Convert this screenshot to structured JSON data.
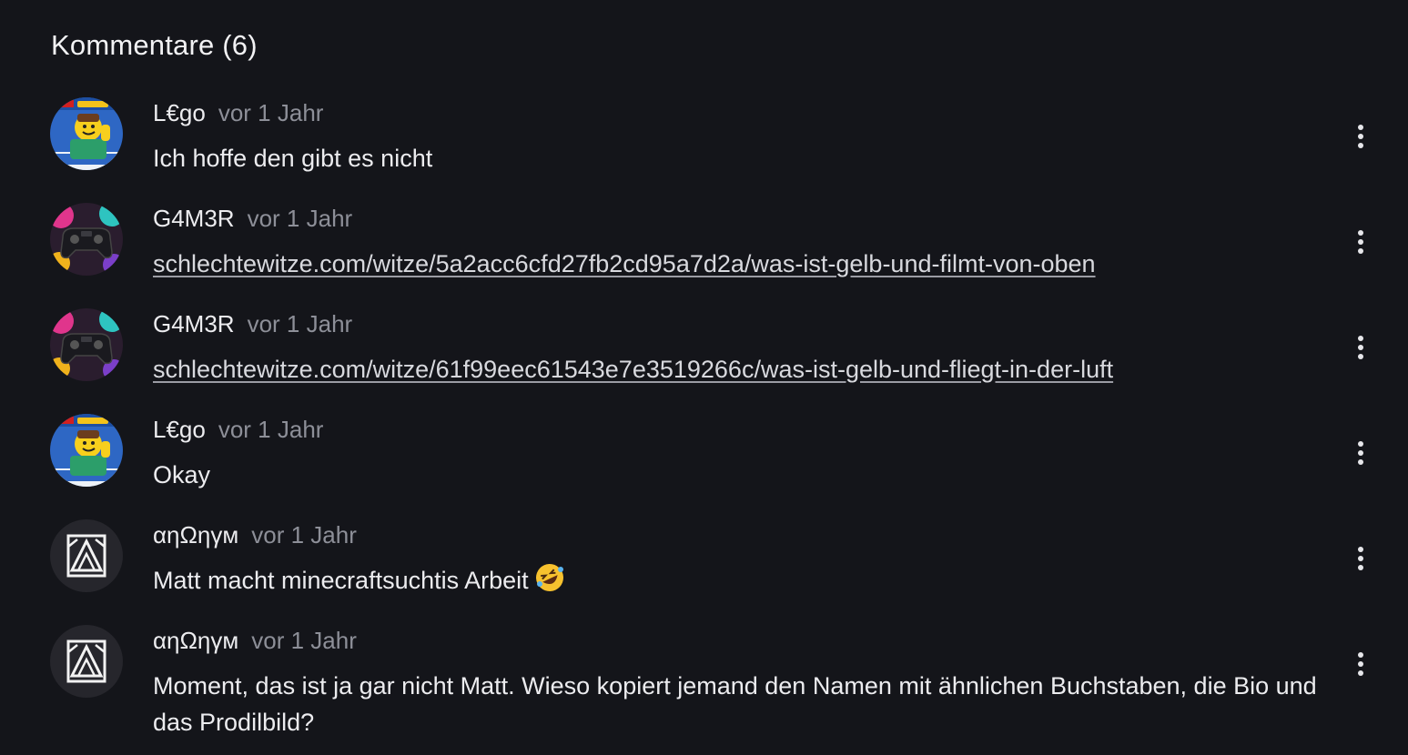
{
  "section": {
    "title": "Kommentare (6)"
  },
  "comments": [
    {
      "author": "L€go",
      "time": "vor 1 Jahr",
      "text": "Ich hoffe den gibt es nicht",
      "avatar_icon": "lego-worlds-avatar"
    },
    {
      "author": "G4M3R",
      "time": "vor 1 Jahr",
      "link": "schlechtewitze.com/witze/5a2acc6cfd27fb2cd95a7d2a/was-ist-gelb-und-filmt-von-oben",
      "avatar_icon": "gamepad-avatar"
    },
    {
      "author": "G4M3R",
      "time": "vor 1 Jahr",
      "link": "schlechtewitze.com/witze/61f99eec61543e7e3519266c/was-ist-gelb-und-fliegt-in-der-luft",
      "avatar_icon": "gamepad-avatar"
    },
    {
      "author": "L€go",
      "time": "vor 1 Jahr",
      "text": "Okay",
      "avatar_icon": "lego-worlds-avatar"
    },
    {
      "author": "αηΩηγм",
      "time": "vor 1 Jahr",
      "text": "Matt macht minecraftsuchtis Arbeit",
      "emoji": "rolling-on-floor-laughing-emoji",
      "avatar_icon": "anonym-logo-avatar"
    },
    {
      "author": "αηΩηγм",
      "time": "vor 1 Jahr",
      "text": "Moment, das ist ja gar nicht Matt. Wieso kopiert jemand den Namen mit ähnlichen Buchstaben, die Bio und das Prodilbild?",
      "avatar_icon": "anonym-logo-avatar"
    }
  ],
  "colors": {
    "background": "#14151a",
    "text": "#ececef",
    "muted": "#8d8f98"
  }
}
